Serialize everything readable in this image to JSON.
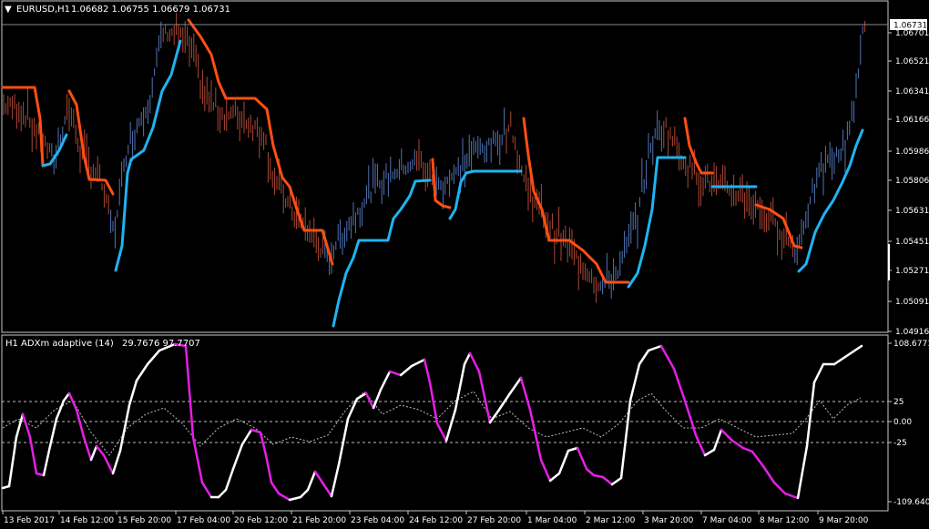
{
  "main_chart": {
    "header": {
      "menu_glyph": "▼",
      "symbol": "EURUSD,H1",
      "ohlc": "1.06682 1.06755 1.06679 1.06731"
    },
    "price_ticks": [
      "1.06701",
      "1.06521",
      "1.06341",
      "1.06166",
      "1.05986",
      "1.05806",
      "1.05631",
      "1.05451",
      "1.05271",
      "1.05091",
      "1.04916"
    ],
    "current_price": "1.06731",
    "colors": {
      "up_trend": "#1fb3f0",
      "down_trend": "#ff4f12",
      "bar_up": "#5b82c8",
      "bar_down": "#c0503c",
      "frame": "#c8c8c8",
      "price_line": "#8c8c8c"
    }
  },
  "indicator": {
    "header": {
      "name": "H1 ADXm adaptive (14)",
      "values": "29.7676 97.7707"
    },
    "axis_ticks": [
      "108.6771",
      "25",
      "0.00",
      "-25",
      "-109.6404"
    ],
    "colors": {
      "rising": "#ffffff",
      "falling": "#e61ee6",
      "signal": "#bdbdbd",
      "levels": "#bdbdbd"
    }
  },
  "time_axis": [
    "13 Feb 2017",
    "14 Feb 12:00",
    "15 Feb 20:00",
    "17 Feb 04:00",
    "20 Feb 12:00",
    "21 Feb 20:00",
    "23 Feb 04:00",
    "24 Feb 12:00",
    "27 Feb 20:00",
    "1 Mar 04:00",
    "2 Mar 12:00",
    "3 Mar 20:00",
    "7 Mar 04:00",
    "8 Mar 12:00",
    "9 Mar 20:00"
  ]
}
